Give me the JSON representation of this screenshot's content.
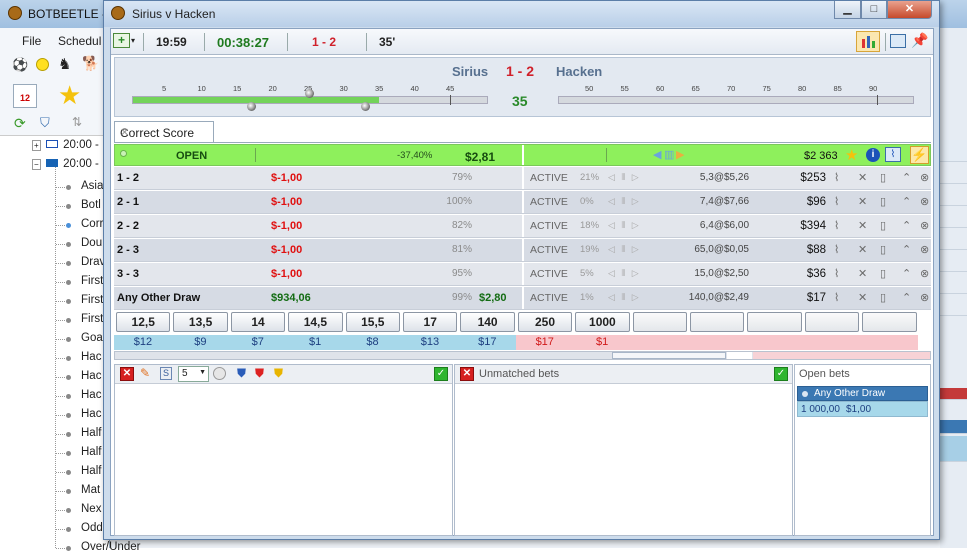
{
  "bg_app": {
    "title": "BOTBEETLE -",
    "menu": [
      "File",
      "Schedul"
    ],
    "tree_times": [
      "20:00 -",
      "20:00 -"
    ],
    "tree_items": [
      "Asia",
      "Botl",
      "Corr",
      "Dou",
      "Drav",
      "First",
      "First",
      "First",
      "Goa",
      "Hac",
      "Hac",
      "Hac",
      "Hac",
      "Half",
      "Half",
      "Half",
      "Mat",
      "Nex",
      "Odd",
      "Over/Under"
    ]
  },
  "window": {
    "title": "Sirius v Hacken",
    "min": "▁",
    "max": "□",
    "close": "✕"
  },
  "toolbar": {
    "time": "19:59",
    "elapsed": "00:38:27",
    "score": "1 - 2",
    "minute": "35'"
  },
  "header": {
    "home": "Sirius",
    "away": "Hacken",
    "score": "1 - 2",
    "minute": "35",
    "ticks_first": [
      "5",
      "10",
      "15",
      "20",
      "25",
      "30",
      "35",
      "40",
      "45"
    ],
    "ticks_second": [
      "50",
      "55",
      "60",
      "65",
      "70",
      "75",
      "80",
      "85",
      "90"
    ]
  },
  "tab": {
    "label": "Correct Score",
    "close": "✕"
  },
  "status": {
    "state": "OPEN",
    "pct": "-37,40%",
    "back_total": "$2,81",
    "lay_total": "$2 363"
  },
  "colors": {
    "status_bg": "#8ef05c",
    "loss": "#e01010",
    "profit": "#136c13",
    "ladder_blue": "#a7d8ea",
    "ladder_pink": "#f8c7cc"
  },
  "rows": [
    {
      "name": "1 - 2",
      "pl": "$-1,00",
      "pct": "79%",
      "back": "",
      "status": "ACTIVE",
      "pc": "21%",
      "odds": "5,3@$5,26",
      "lay": "$253"
    },
    {
      "name": "2 - 1",
      "pl": "$-1,00",
      "pct": "100%",
      "back": "",
      "status": "ACTIVE",
      "pc": "0%",
      "odds": "7,4@$7,66",
      "lay": "$96"
    },
    {
      "name": "2 - 2",
      "pl": "$-1,00",
      "pct": "82%",
      "back": "",
      "status": "ACTIVE",
      "pc": "18%",
      "odds": "6,4@$6,00",
      "lay": "$394"
    },
    {
      "name": "2 - 3",
      "pl": "$-1,00",
      "pct": "81%",
      "back": "",
      "status": "ACTIVE",
      "pc": "19%",
      "odds": "65,0@$0,05",
      "lay": "$88"
    },
    {
      "name": "3 - 3",
      "pl": "$-1,00",
      "pct": "95%",
      "back": "",
      "status": "ACTIVE",
      "pc": "5%",
      "odds": "15,0@$2,50",
      "lay": "$36"
    },
    {
      "name": "Any Other Draw",
      "pl": "$934,06",
      "pct": "99%",
      "back": "$2,80",
      "status": "ACTIVE",
      "pc": "1%",
      "odds": "140,0@$2,49",
      "lay": "$17"
    }
  ],
  "ladder": {
    "prices": [
      "12,5",
      "13,5",
      "14",
      "14,5",
      "15,5",
      "17",
      "140",
      "250",
      "1000",
      "",
      "",
      "",
      "",
      ""
    ],
    "amounts": [
      "$12",
      "$9",
      "$7",
      "$1",
      "$8",
      "$13",
      "$17",
      "$17",
      "$1"
    ]
  },
  "panels": {
    "stake": "5",
    "unmatched_title": "Unmatched bets",
    "open_title": "Open bets",
    "open_bet": {
      "name": "Any Other Draw",
      "odds": "1 000,00",
      "stake": "$1,00"
    }
  }
}
